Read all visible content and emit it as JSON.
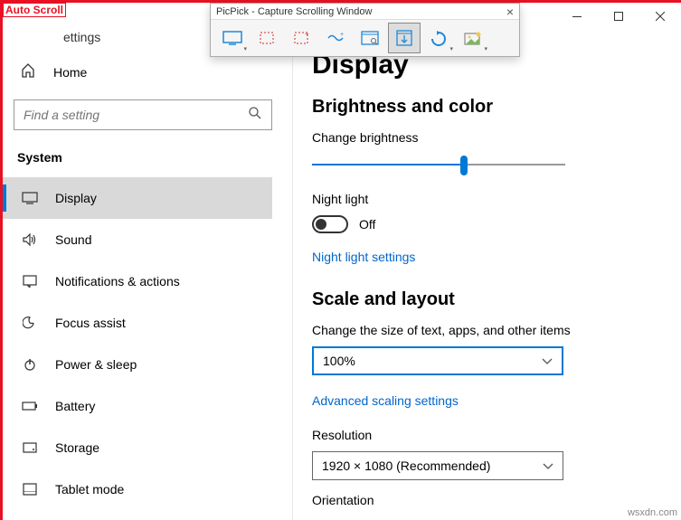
{
  "autoscroll_label": "Auto Scroll",
  "header_text": "ettings",
  "home_label": "Home",
  "search_placeholder": "Find a setting",
  "category_label": "System",
  "nav": [
    {
      "label": "Display",
      "active": true
    },
    {
      "label": "Sound"
    },
    {
      "label": "Notifications & actions"
    },
    {
      "label": "Focus assist"
    },
    {
      "label": "Power & sleep"
    },
    {
      "label": "Battery"
    },
    {
      "label": "Storage"
    },
    {
      "label": "Tablet mode"
    }
  ],
  "main": {
    "title": "Display",
    "brightness_section": "Brightness and color",
    "brightness_label": "Change brightness",
    "nightlight_label": "Night light",
    "toggle_state": "Off",
    "nightlight_link": "Night light settings",
    "scale_section": "Scale and layout",
    "scale_label": "Change the size of text, apps, and other items",
    "scale_value": "100%",
    "scale_link": "Advanced scaling settings",
    "resolution_label": "Resolution",
    "resolution_value": "1920 × 1080 (Recommended)",
    "orientation_label": "Orientation"
  },
  "picpick": {
    "title": "PicPick - Capture Scrolling Window"
  },
  "watermark": "wsxdn.com"
}
